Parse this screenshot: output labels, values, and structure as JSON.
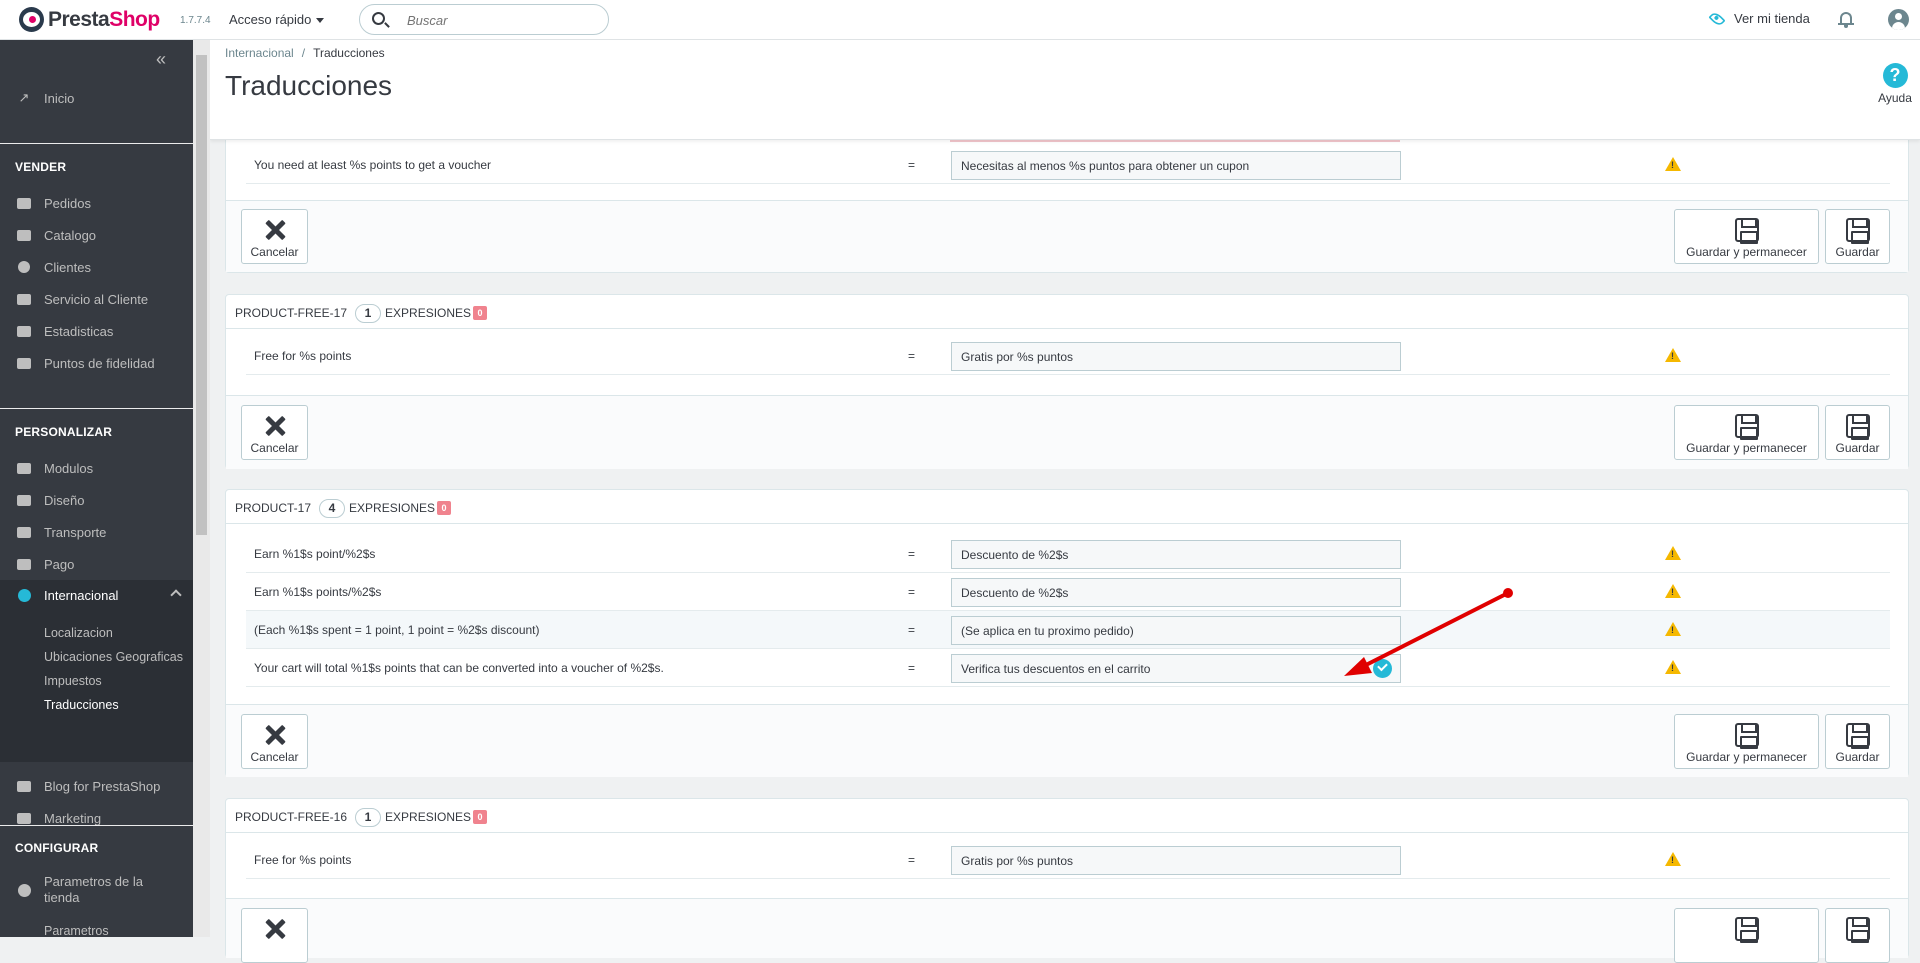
{
  "header": {
    "brand_a": "Presta",
    "brand_b": "Shop",
    "version": "1.7.7.4",
    "quick_access": "Acceso rápido",
    "search_placeholder": "Buscar",
    "view_store": "Ver mi tienda"
  },
  "sidebar": {
    "home": "Inicio",
    "sections": {
      "sell": "VENDER",
      "customize": "PERSONALIZAR",
      "configure": "CONFIGURAR"
    },
    "sell_items": [
      "Pedidos",
      "Catalogo",
      "Clientes",
      "Servicio al Cliente",
      "Estadisticas",
      "Puntos de fidelidad"
    ],
    "customize_items": [
      "Modulos",
      "Diseño",
      "Transporte",
      "Pago",
      "Internacional"
    ],
    "international_sub": [
      "Localizacion",
      "Ubicaciones Geograficas",
      "Impuestos",
      "Traducciones"
    ],
    "extra_items": [
      "Blog for PrestaShop",
      "Marketing"
    ],
    "configure_items": [
      "Parametros de la tienda",
      "Parametros"
    ]
  },
  "page": {
    "breadcrumb": [
      "Internacional",
      "Traducciones"
    ],
    "title": "Traducciones",
    "help": "Ayuda"
  },
  "buttons": {
    "cancel": "Cancelar",
    "save_stay": "Guardar y permanecer",
    "save": "Guardar"
  },
  "panels": [
    {
      "rows": [
        {
          "source": "You need at least %s points to get a voucher",
          "eq": "=",
          "translation": "Necesitas al menos %s puntos para obtener un cupon"
        }
      ]
    },
    {
      "name": "PRODUCT-FREE-17",
      "count": "1",
      "label": "EXPRESIONES",
      "missing": "0",
      "rows": [
        {
          "source": "Free for %s points",
          "eq": "=",
          "translation": "Gratis por %s puntos"
        }
      ]
    },
    {
      "name": "PRODUCT-17",
      "count": "4",
      "label": "EXPRESIONES",
      "missing": "0",
      "rows": [
        {
          "source": "Earn %1$s point/%2$s",
          "eq": "=",
          "translation": "Descuento de %2$s"
        },
        {
          "source": "Earn %1$s points/%2$s",
          "eq": "=",
          "translation": "Descuento de %2$s"
        },
        {
          "source": "(Each %1$s spent = 1 point, 1 point = %2$s discount)",
          "eq": "=",
          "translation": "(Se aplica en tu proximo pedido)"
        },
        {
          "source": "Your cart will total %1$s points that can be converted into a voucher of %2$s.",
          "eq": "=",
          "translation": "Verifica tus descuentos en el carrito"
        }
      ]
    },
    {
      "name": "PRODUCT-FREE-16",
      "count": "1",
      "label": "EXPRESIONES",
      "missing": "0",
      "rows": [
        {
          "source": "Free for %s points",
          "eq": "=",
          "translation": "Gratis por %s puntos"
        }
      ]
    }
  ],
  "colors": {
    "accent": "#25b9d7",
    "brand_pink": "#df0067",
    "sidebar_bg": "#363a41",
    "warning": "#f5b800",
    "arrow": "#e00000"
  }
}
